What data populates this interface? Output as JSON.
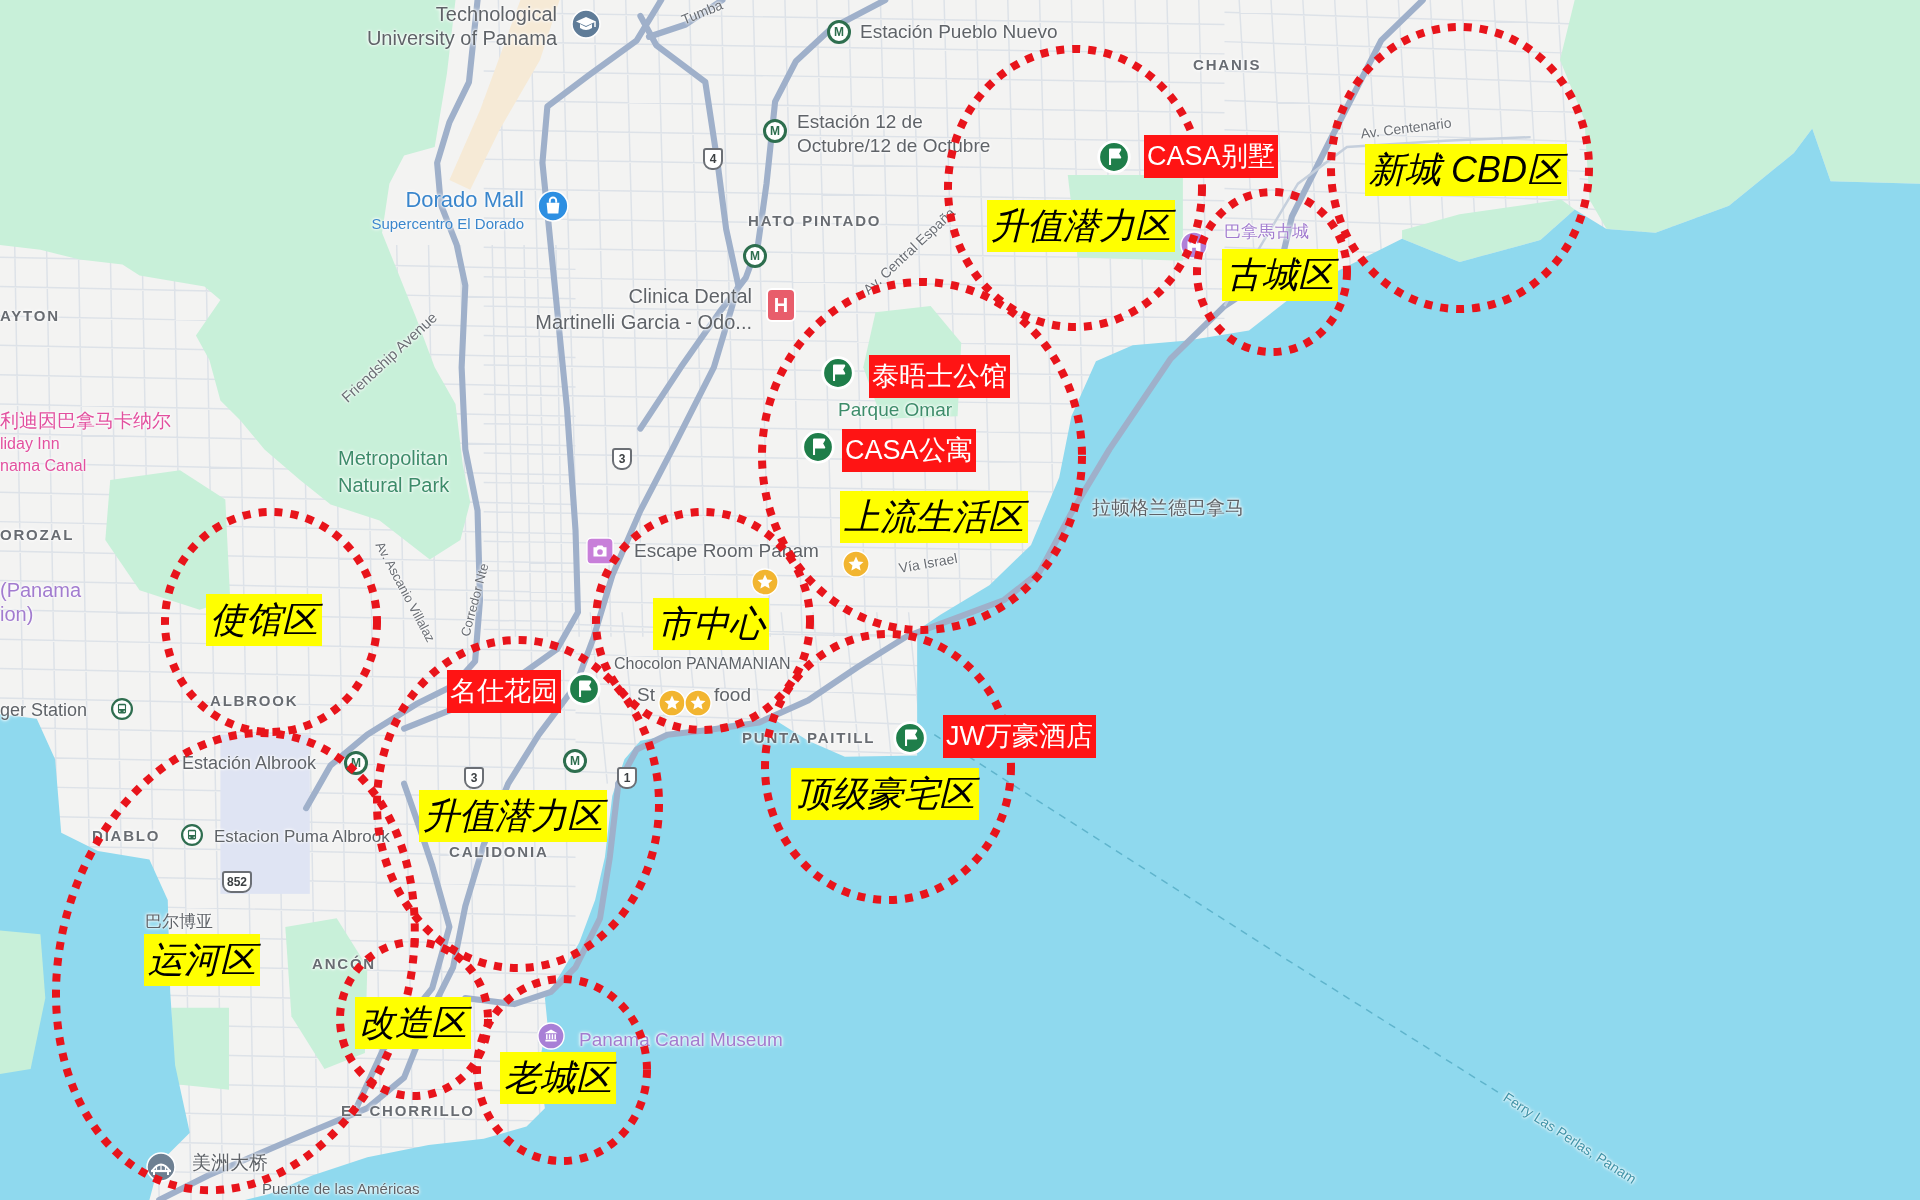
{
  "map": {
    "labels": [
      {
        "text": "Tumba",
        "kind": "road"
      },
      {
        "lines": [
          "Technological",
          "University of Panama"
        ],
        "kind": "place"
      },
      {
        "text": "Estación Pueblo Nuevo",
        "kind": "place"
      },
      {
        "text": "CHANIS",
        "kind": "district"
      },
      {
        "lines": [
          "Estación 12 de",
          "Octubre/12 de Octubre"
        ],
        "kind": "place"
      },
      {
        "text": "Av. Centenario",
        "kind": "road"
      },
      {
        "text": "HATO PINTADO",
        "kind": "district"
      },
      {
        "text": "Dorado Mall",
        "kind": "shop"
      },
      {
        "text": "Supercentro El Dorado",
        "kind": "shop"
      },
      {
        "text": "巴拿馬古城",
        "kind": "attraction"
      },
      {
        "text": "Av. Central España",
        "kind": "road"
      },
      {
        "text": "AYTON",
        "kind": "district"
      },
      {
        "lines": [
          "Clinica Dental",
          "Martinelli Garcia - Odo..."
        ],
        "kind": "place"
      },
      {
        "text": "Friendship Avenue",
        "kind": "road"
      },
      {
        "text": "Parque Omar",
        "kind": "park"
      },
      {
        "text": "利迪因巴拿马卡纳尔",
        "kind": "hotel"
      },
      {
        "text": "liday Inn",
        "kind": "hotel"
      },
      {
        "text": "nama Canal",
        "kind": "hotel"
      },
      {
        "lines": [
          "Metropolitan",
          "Natural Park"
        ],
        "kind": "park"
      },
      {
        "text": "拉顿格兰德巴拿马",
        "kind": "place"
      },
      {
        "text": "OROZAL",
        "kind": "district"
      },
      {
        "text": "Escape Room Panam",
        "kind": "place"
      },
      {
        "text": "Vía Israel",
        "kind": "road"
      },
      {
        "text": "Av. Ascanio Villalaz",
        "kind": "road"
      },
      {
        "text": "Corredor Nte",
        "kind": "road"
      },
      {
        "lines": [
          "(Panama",
          "ion)"
        ],
        "kind": "attraction"
      },
      {
        "text": "Chocolon PANAMANIAN",
        "kind": "place"
      },
      {
        "text": "St",
        "kind": "place"
      },
      {
        "text": "food",
        "kind": "place"
      },
      {
        "text": "ALBROOK",
        "kind": "district"
      },
      {
        "text": "ger Station",
        "kind": "place"
      },
      {
        "text": "PUNTA PAITILL",
        "kind": "district"
      },
      {
        "text": "Estación Albrook",
        "kind": "place"
      },
      {
        "text": "DIABLO",
        "kind": "district"
      },
      {
        "text": "Estacion Puma Albrook",
        "kind": "place"
      },
      {
        "text": "CALIDONIA",
        "kind": "district"
      },
      {
        "text": "巴尔博亚",
        "kind": "place"
      },
      {
        "text": "ANCÓN",
        "kind": "district"
      },
      {
        "text": "Panama Canal Museum",
        "kind": "attraction"
      },
      {
        "text": "EL CHORRILLO",
        "kind": "district"
      },
      {
        "text": "美洲大桥",
        "kind": "place"
      },
      {
        "text": "Puente de las Américas",
        "kind": "place"
      },
      {
        "text": "Ferry Las Perlas, Panam",
        "kind": "ferry"
      }
    ],
    "markers": [
      {
        "kind": "school"
      },
      {
        "kind": "metro",
        "text": "M"
      },
      {
        "kind": "metro",
        "text": "M"
      },
      {
        "kind": "route",
        "text": "4"
      },
      {
        "kind": "shopping"
      },
      {
        "kind": "landmark"
      },
      {
        "kind": "metro",
        "text": "M"
      },
      {
        "kind": "hospital",
        "text": "H"
      },
      {
        "kind": "route",
        "text": "3"
      },
      {
        "kind": "camera"
      },
      {
        "kind": "star"
      },
      {
        "kind": "star"
      },
      {
        "kind": "star"
      },
      {
        "kind": "star"
      },
      {
        "kind": "bus"
      },
      {
        "kind": "metro",
        "text": "M"
      },
      {
        "kind": "metro",
        "text": "M"
      },
      {
        "kind": "route",
        "text": "3"
      },
      {
        "kind": "route",
        "text": "1"
      },
      {
        "kind": "bus"
      },
      {
        "kind": "route",
        "text": "852"
      },
      {
        "kind": "museum"
      },
      {
        "kind": "bridge"
      }
    ]
  },
  "annotations": {
    "zones": [
      {
        "label": "升值潜力区"
      },
      {
        "label": "新城 CBD区"
      },
      {
        "label": "古城区"
      },
      {
        "label": "上流生活区"
      },
      {
        "label": "使馆区"
      },
      {
        "label": "市中心"
      },
      {
        "label": "升值潜力区"
      },
      {
        "label": "顶级豪宅区"
      },
      {
        "label": "运河区"
      },
      {
        "label": "改造区"
      },
      {
        "label": "老城区"
      }
    ],
    "properties": [
      {
        "label": "CASA别墅"
      },
      {
        "label": "泰晤士公馆"
      },
      {
        "label": "CASA公寓"
      },
      {
        "label": "名仕花园"
      },
      {
        "label": "JW万豪酒店"
      }
    ]
  }
}
